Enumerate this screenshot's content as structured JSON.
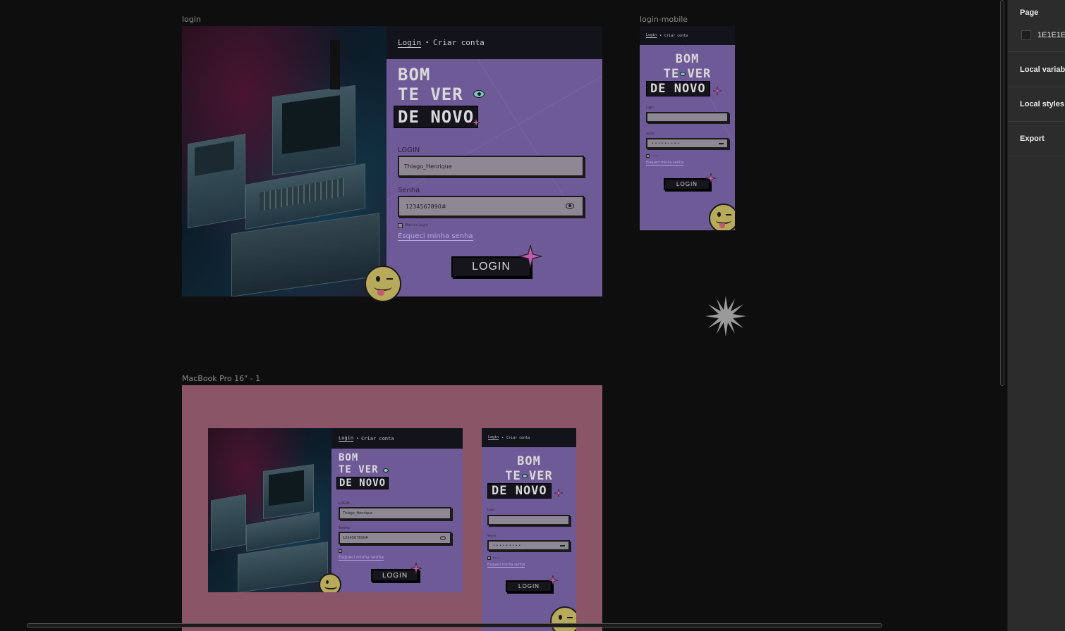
{
  "canvas": {
    "background": "#0e0e0e",
    "frames": {
      "login": {
        "label": "login"
      },
      "login_mobile": {
        "label": "login-mobile"
      },
      "macbook": {
        "label": "MacBook Pro 16\" - 1"
      }
    }
  },
  "login_screen": {
    "nav": {
      "login_tab": "Login",
      "separator": "•",
      "create_tab": "Criar conta"
    },
    "heading": {
      "line1": "BOM",
      "line2": "TE VER",
      "line3": "DE NOVO"
    },
    "login_field": {
      "label": "LOGIN",
      "value": "Thiago_Henrique"
    },
    "password_field": {
      "label": "Senha",
      "value": "1234567890#"
    },
    "remember_label": "Manter Login",
    "forgot_link": "Esqueci minha senha",
    "login_button": "LOGIN"
  },
  "mobile_screen": {
    "nav": {
      "login_tab": "Login",
      "separator": "•",
      "create_tab": "Criar conta"
    },
    "heading": {
      "line1": "BOM",
      "line2": "TE VER",
      "line3": "DE NOVO"
    },
    "login_field": {
      "label": "Login"
    },
    "password_field": {
      "label": "Senha",
      "value": "• • • • • • • • •"
    },
    "remember_label": "Manter",
    "forgot_link": "Esqueci minha senha",
    "login_button": "LOGIN"
  },
  "colors": {
    "purple_panel": "#6f5a98",
    "topbar": "#13131b",
    "macbook_bg": "#8a5566",
    "sparkle": "#c45ab0",
    "smiley": "#b7aa5a"
  },
  "right_panel": {
    "page_title": "Page",
    "page_color": "1E1E1E",
    "local_variables": "Local variab",
    "local_styles": "Local styles",
    "export": "Export"
  }
}
